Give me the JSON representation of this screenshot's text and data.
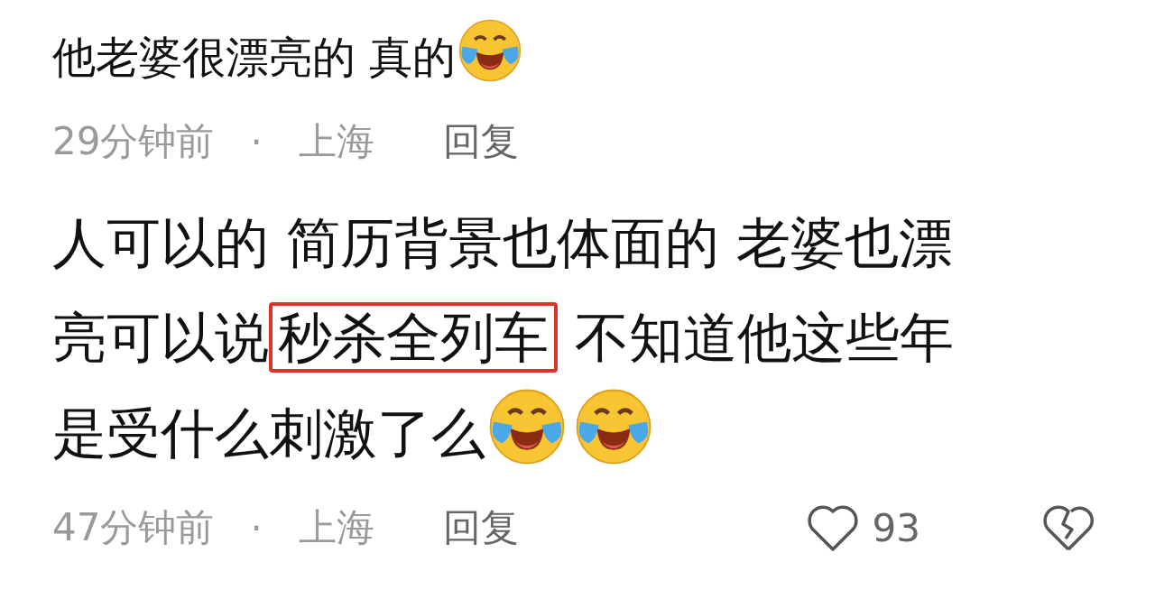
{
  "comments": [
    {
      "segments": [
        {
          "text": "他老婆很漂亮的 真的",
          "highlighted": false
        }
      ],
      "emojis": [
        {
          "kind": "laughing-crying"
        }
      ],
      "time": "29分钟前",
      "separator": "·",
      "location": "上海",
      "reply": "回复"
    },
    {
      "segments": [
        {
          "text": "人可以的 简历背景也体面的 老婆也漂亮可以说",
          "highlighted": false
        },
        {
          "text": "秒杀全列车",
          "highlighted": true
        },
        {
          "text": " 不知道他这些年是受什么刺激了么",
          "highlighted": false
        }
      ],
      "emojis": [
        {
          "kind": "laughing-crying"
        },
        {
          "kind": "laughing-crying"
        }
      ],
      "time": "47分钟前",
      "separator": "·",
      "location": "上海",
      "reply": "回复",
      "likes": "93"
    }
  ]
}
